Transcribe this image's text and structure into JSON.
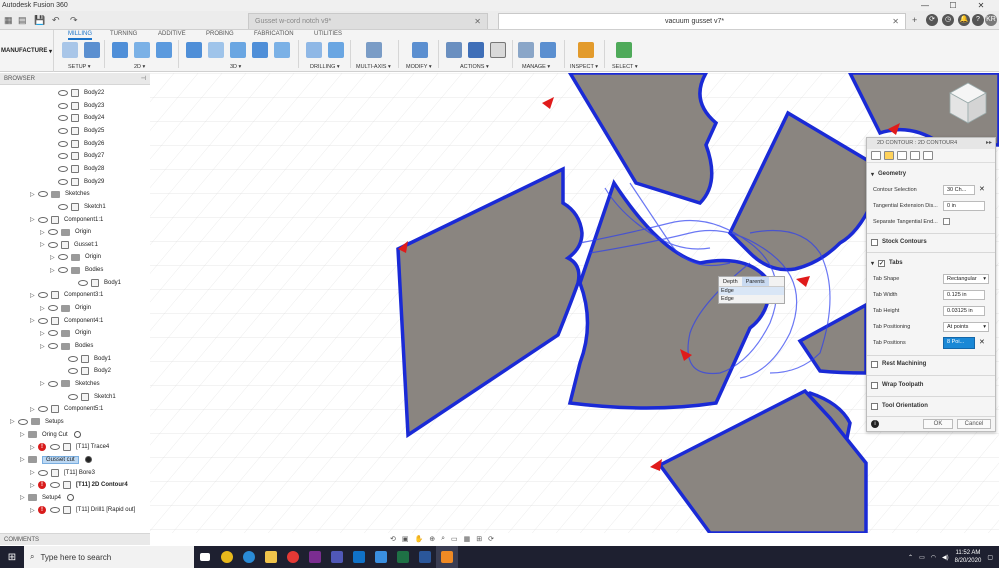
{
  "window": {
    "title": "Autodesk Fusion 360",
    "minimize": "—",
    "maximize": "☐",
    "close": "✕"
  },
  "tabs": [
    {
      "label": "Gusset w-cord notch v9*",
      "active": false
    },
    {
      "label": "vacuum gusset v7*",
      "active": true
    }
  ],
  "user_initials": "KR",
  "workspace": {
    "label": "MANUFACTURE"
  },
  "ribbon_tabs": [
    "MILLING",
    "TURNING",
    "ADDITIVE",
    "PROBING",
    "FABRICATION",
    "UTILITIES"
  ],
  "ribbon_groups": [
    "SETUP",
    "2D",
    "3D",
    "DRILLING",
    "MULTI-AXIS",
    "MODIFY",
    "ACTIONS",
    "MANAGE",
    "INSPECT",
    "SELECT"
  ],
  "browser": {
    "header": "BROWSER",
    "rows": [
      {
        "label": "Body22",
        "indent": 50,
        "kind": "body"
      },
      {
        "label": "Body23",
        "indent": 50,
        "kind": "body"
      },
      {
        "label": "Body24",
        "indent": 50,
        "kind": "body"
      },
      {
        "label": "Body25",
        "indent": 50,
        "kind": "body"
      },
      {
        "label": "Body26",
        "indent": 50,
        "kind": "body"
      },
      {
        "label": "Body27",
        "indent": 50,
        "kind": "body"
      },
      {
        "label": "Body28",
        "indent": 50,
        "kind": "body"
      },
      {
        "label": "Body29",
        "indent": 50,
        "kind": "body"
      },
      {
        "label": "Sketches",
        "indent": 30,
        "kind": "folder"
      },
      {
        "label": "Sketch1",
        "indent": 50,
        "kind": "sketch"
      },
      {
        "label": "Component1:1",
        "indent": 30,
        "kind": "comp"
      },
      {
        "label": "Origin",
        "indent": 40,
        "kind": "folder"
      },
      {
        "label": "Gusset:1",
        "indent": 40,
        "kind": "comp"
      },
      {
        "label": "Origin",
        "indent": 50,
        "kind": "folder"
      },
      {
        "label": "Bodies",
        "indent": 50,
        "kind": "folder"
      },
      {
        "label": "Body1",
        "indent": 70,
        "kind": "body"
      },
      {
        "label": "Component3:1",
        "indent": 30,
        "kind": "comp"
      },
      {
        "label": "Origin",
        "indent": 40,
        "kind": "folder"
      },
      {
        "label": "Component4:1",
        "indent": 30,
        "kind": "comp"
      },
      {
        "label": "Origin",
        "indent": 40,
        "kind": "folder"
      },
      {
        "label": "Bodies",
        "indent": 40,
        "kind": "folder"
      },
      {
        "label": "Body1",
        "indent": 60,
        "kind": "body"
      },
      {
        "label": "Body2",
        "indent": 60,
        "kind": "body"
      },
      {
        "label": "Sketches",
        "indent": 40,
        "kind": "folder"
      },
      {
        "label": "Sketch1",
        "indent": 60,
        "kind": "sketch"
      },
      {
        "label": "Component5:1",
        "indent": 30,
        "kind": "comp"
      },
      {
        "label": "Setups",
        "indent": 10,
        "kind": "folder"
      },
      {
        "label": "Oring Cut",
        "indent": 20,
        "kind": "setup"
      },
      {
        "label": "[T11] Trace4",
        "indent": 30,
        "kind": "op-warn"
      },
      {
        "label": "Gusset cut",
        "indent": 20,
        "kind": "setup-active"
      },
      {
        "label": "[T11] Bore3",
        "indent": 30,
        "kind": "op"
      },
      {
        "label": "[T11] 2D Contour4",
        "indent": 30,
        "kind": "op-warn-bold"
      },
      {
        "label": "Setup4",
        "indent": 20,
        "kind": "setup"
      },
      {
        "label": "[T11] Drill1 [Rapid out]",
        "indent": 30,
        "kind": "op-warn"
      }
    ]
  },
  "comments": {
    "label": "COMMENTS"
  },
  "dialog": {
    "title": "2D CONTOUR : 2D CONTOUR4",
    "geometry": {
      "header": "Geometry",
      "contour_selection_label": "Contour Selection",
      "contour_selection_value": "30 Ch...",
      "tangential_ext_label": "Tangential Extension Dis...",
      "tangential_ext_value": "0 in",
      "separate_tangential_label": "Separate Tangential End..."
    },
    "stock_contours": "Stock Contours",
    "tabs": {
      "header": "Tabs",
      "shape_label": "Tab Shape",
      "shape_value": "Rectangular",
      "width_label": "Tab Width",
      "width_value": "0.125 in",
      "height_label": "Tab Height",
      "height_value": "0.03125 in",
      "positioning_label": "Tab Positioning",
      "positioning_value": "At points",
      "positions_label": "Tab Positions",
      "positions_value": "8 Poi..."
    },
    "rest_machining": "Rest Machining",
    "wrap_toolpath": "Wrap Toolpath",
    "tool_orientation": "Tool Orientation",
    "ok": "OK",
    "cancel": "Cancel"
  },
  "depth_popup": {
    "tab1": "Depth",
    "tab2": "Parents",
    "item1": "Edge",
    "item2": "Edge"
  },
  "taskbar": {
    "search_placeholder": "Type here to search",
    "time": "11:52 AM",
    "date": "8/20/2020"
  },
  "colors": {
    "part_fill": "#8a8580",
    "part_outline": "#1a2ad6",
    "toolpath": "#2d3ff0",
    "accent_blue": "#1a73c9"
  }
}
